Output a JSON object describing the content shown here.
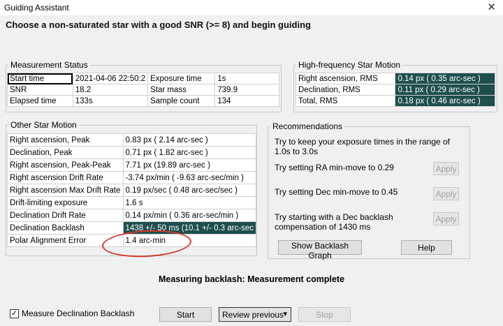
{
  "window": {
    "title": "Guiding Assistant",
    "close": "✕"
  },
  "instruction": "Choose a non-saturated star with a good SNR (>= 8) and begin guiding",
  "measurement_status": {
    "label": "Measurement Status",
    "rows": [
      [
        "Start time",
        "2021-04-06 22:50:2",
        "Exposure time",
        "1s"
      ],
      [
        "SNR",
        "18.2",
        "Star mass",
        "739.9"
      ],
      [
        "Elapsed time",
        "133s",
        "Sample count",
        "134"
      ]
    ]
  },
  "high_freq": {
    "label": "High-frequency Star Motion",
    "rows": [
      [
        "Right ascension, RMS",
        "0.14 px ( 0.35 arc-sec )"
      ],
      [
        "Declination, RMS",
        "0.11 px ( 0.29 arc-sec )"
      ],
      [
        "Total, RMS",
        "0.18 px ( 0.46 arc-sec )"
      ]
    ]
  },
  "other_motion": {
    "label": "Other Star Motion",
    "rows": [
      [
        "Right ascension, Peak",
        "0.83 px ( 2.14 arc-sec )"
      ],
      [
        "Declination, Peak",
        "0.71 px ( 1.82 arc-sec )"
      ],
      [
        "Right ascension, Peak-Peak",
        "7.71 px (19.89 arc-sec )"
      ],
      [
        "Right ascension Drift Rate",
        "-3.74 px/min ( -9.63 arc-sec/min )"
      ],
      [
        "Right ascension Max Drift Rate",
        "0.19 px/sec ( 0.48 arc-sec/sec )"
      ],
      [
        "Drift-limiting exposure",
        "1.6 s"
      ],
      [
        "Declination Drift Rate",
        "0.14 px/min ( 0.36 arc-sec/min )"
      ],
      [
        "Declination Backlash",
        "1438 +/- 50 ms (10.1 +/- 0.3 arc-sec"
      ],
      [
        "Polar Alignment Error",
        "1.4 arc-min"
      ]
    ]
  },
  "recommendations": {
    "label": "Recommendations",
    "exposure": "Try to keep your exposure times in the range of 1.0s to 3.0s",
    "ra_text": "Try setting RA min-move to 0.29",
    "dec_text": "Try setting Dec min-move to 0.45",
    "backlash_text": "Try starting with a Dec backlash compensation of 1430 ms",
    "apply": "Apply",
    "show_graph": "Show Backlash Graph",
    "help": "Help"
  },
  "status": "Measuring backlash: Measurement complete",
  "footer": {
    "checkbox_label": "Measure Declination Backlash",
    "checkbox_checked": "✓",
    "start": "Start",
    "review": "Review previous",
    "review_arrow": "▾",
    "stop": "Stop"
  },
  "colors": {
    "highlight": "#1e4e4e",
    "annotation": "#d23a2a"
  }
}
